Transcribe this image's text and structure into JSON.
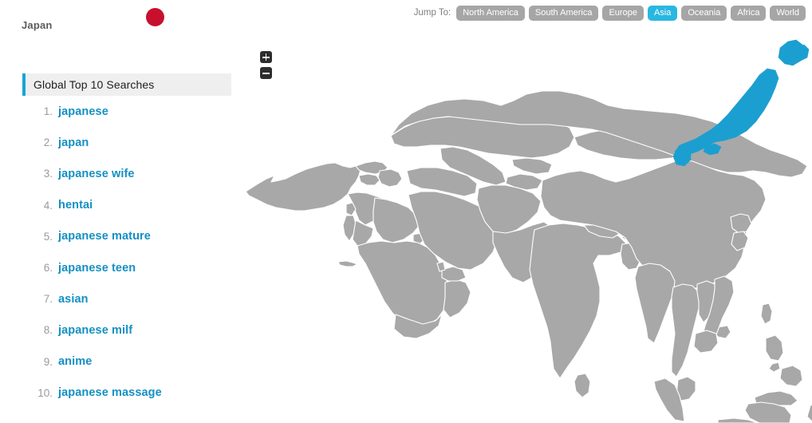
{
  "country": {
    "name": "Japan",
    "flag_icon": "japan-flag-icon",
    "flag_disc_color": "#c8102e"
  },
  "jump_to": {
    "label": "Jump To:",
    "active": "Asia",
    "active_color": "#29b7e0",
    "inactive_color": "#a6a6a6",
    "regions": [
      {
        "label": "North America",
        "active": false
      },
      {
        "label": "South America",
        "active": false
      },
      {
        "label": "Europe",
        "active": false
      },
      {
        "label": "Asia",
        "active": true
      },
      {
        "label": "Oceania",
        "active": false
      },
      {
        "label": "Africa",
        "active": false
      },
      {
        "label": "World",
        "active": false
      }
    ]
  },
  "searches": {
    "title": "Global Top 10 Searches",
    "accent_color": "#17a5d4",
    "header_bg": "#efefef",
    "link_color": "#1490c4",
    "items": [
      {
        "rank": "1.",
        "term": "japanese"
      },
      {
        "rank": "2.",
        "term": "japan"
      },
      {
        "rank": "3.",
        "term": "japanese wife"
      },
      {
        "rank": "4.",
        "term": "hentai"
      },
      {
        "rank": "5.",
        "term": "japanese mature"
      },
      {
        "rank": "6.",
        "term": "japanese teen"
      },
      {
        "rank": "7.",
        "term": "asian"
      },
      {
        "rank": "8.",
        "term": "japanese milf"
      },
      {
        "rank": "9.",
        "term": "anime"
      },
      {
        "rank": "10.",
        "term": "japanese massage"
      }
    ]
  },
  "map": {
    "region": "Asia",
    "land_color": "#a8a8a8",
    "border_color": "#ffffff",
    "selected_country": "Japan",
    "selected_color": "#1b9fd0",
    "background": "#ffffff"
  },
  "zoom_controls": {
    "zoom_in_icon": "plus-icon",
    "zoom_out_icon": "minus-icon",
    "zoom_in_label": "+",
    "zoom_out_label": "−"
  }
}
